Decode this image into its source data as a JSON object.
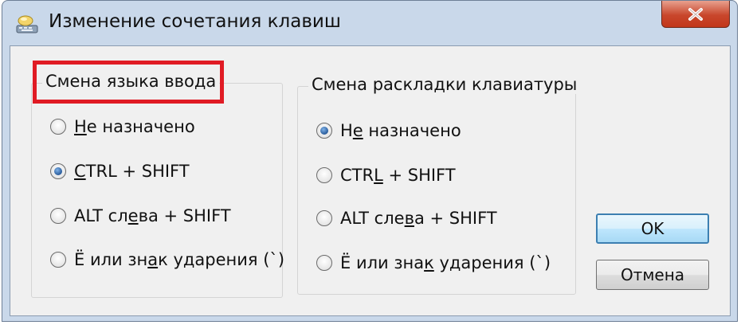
{
  "window": {
    "title": "Изменение сочетания клавиш",
    "close_icon": "close-x-icon",
    "title_icon": "keyboard-icon"
  },
  "input_language_group": {
    "title": "Смена языка ввода",
    "options": [
      {
        "pre": "",
        "ul": "Н",
        "post": "е назначено",
        "checked": false
      },
      {
        "pre": "",
        "ul": "C",
        "post": "TRL + SHIFT",
        "checked": true
      },
      {
        "pre": "ALT сл",
        "ul": "е",
        "post": "ва + SHIFT",
        "checked": false
      },
      {
        "pre": "Ё или зн",
        "ul": "а",
        "post": "к ударения (`)",
        "checked": false
      }
    ]
  },
  "keyboard_layout_group": {
    "title": "Смена раскладки клавиатуры",
    "options": [
      {
        "pre": "Н",
        "ul": "е",
        "post": " назначено",
        "checked": true
      },
      {
        "pre": "CTR",
        "ul": "L",
        "post": " + SHIFT",
        "checked": false
      },
      {
        "pre": "ALT сле",
        "ul": "в",
        "post": "а + SHIFT",
        "checked": false
      },
      {
        "pre": "Ё или зна",
        "ul": "к",
        "post": " ударения (`)",
        "checked": false
      }
    ]
  },
  "buttons": {
    "ok_label": "OK",
    "cancel_label": "Отмена"
  },
  "colors": {
    "highlight": "#e01b24",
    "close_button": "#c8472c",
    "title_bar": "#c9d8ea"
  }
}
